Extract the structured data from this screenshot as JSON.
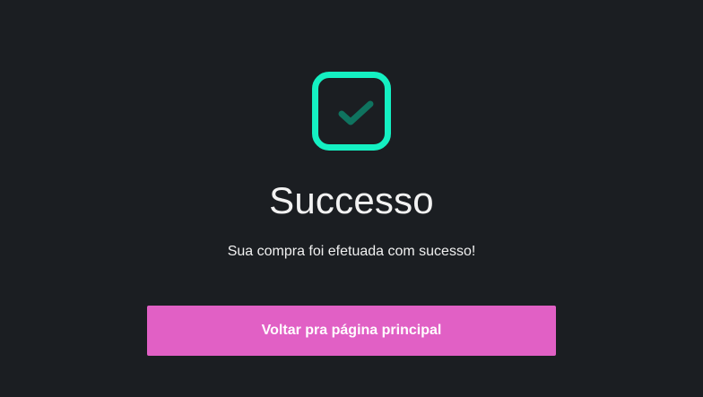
{
  "success": {
    "icon": "check-square-icon",
    "title": "Successo",
    "message": "Sua compra foi efetuada com sucesso!",
    "button_label": "Voltar pra página principal"
  },
  "colors": {
    "background": "#1b1e22",
    "icon_border": "#14f0c2",
    "check": "#0f735f",
    "button": "#e160c5",
    "text": "#f2f2f2"
  }
}
